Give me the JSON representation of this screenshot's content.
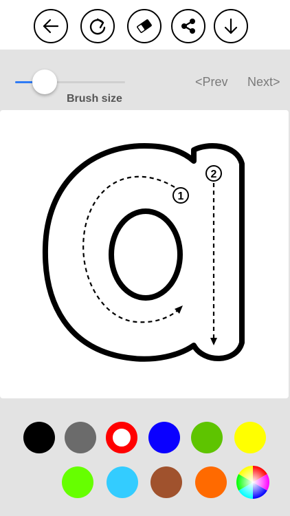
{
  "toolbar": {
    "buttons": [
      {
        "name": "back-button",
        "icon": "arrow-left-icon"
      },
      {
        "name": "redo-button",
        "icon": "rotate-clockwise-icon"
      },
      {
        "name": "eraser-button",
        "icon": "eraser-icon"
      },
      {
        "name": "share-button",
        "icon": "share-icon"
      },
      {
        "name": "download-button",
        "icon": "arrow-down-icon"
      }
    ]
  },
  "controls": {
    "brush_label": "Brush size",
    "brush_level": 0.27,
    "prev_label": "<Prev",
    "next_label": "Next>"
  },
  "canvas": {
    "letter": "a",
    "stroke_numbers": [
      "1",
      "2"
    ]
  },
  "palette": {
    "colors": [
      "#000000",
      "#6b6b6b",
      "#ffffff",
      "#0a00ff",
      "#5ec400",
      "#ffff00",
      "#66ff00",
      "#33ccff",
      "#a0522d",
      "#ff6a00"
    ],
    "selected_index": 2,
    "selected_ring": "#ff0000",
    "custom": "color-wheel-icon"
  }
}
